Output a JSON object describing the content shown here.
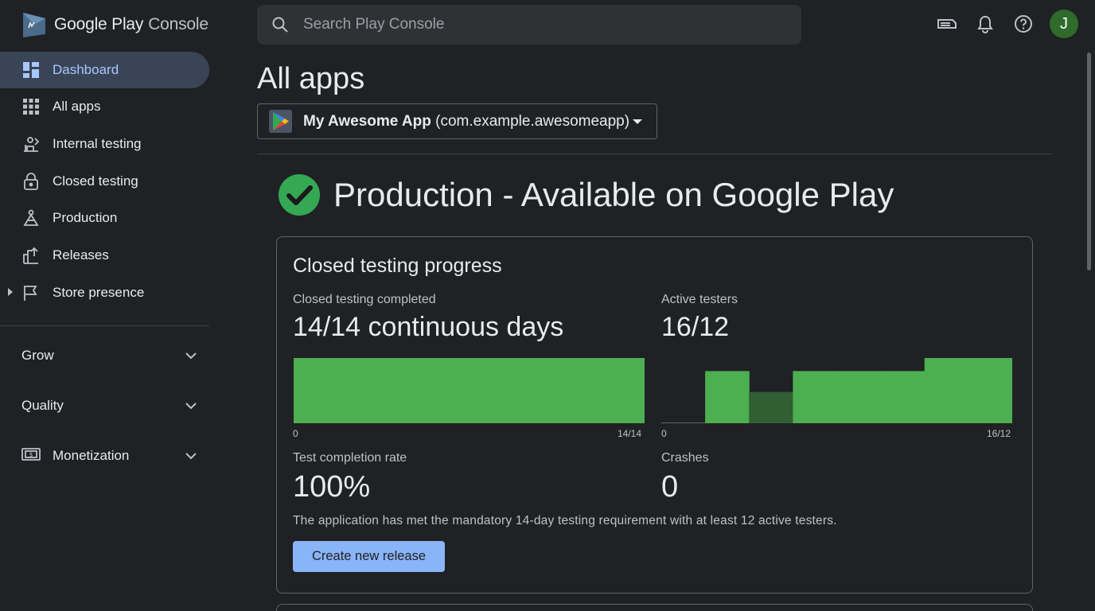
{
  "brand": {
    "google": "Google Play",
    "console": "Console"
  },
  "search": {
    "placeholder": "Search Play Console"
  },
  "topbar": {
    "icons": [
      "inbox-icon",
      "bell-icon",
      "help-icon"
    ],
    "avatar_letter": "J"
  },
  "sidebar": {
    "items": [
      {
        "label": "Dashboard",
        "icon": "dashboard-icon",
        "active": true
      },
      {
        "label": "All apps",
        "icon": "grid-icon"
      },
      {
        "label": "Internal testing",
        "icon": "internal-testing-icon"
      },
      {
        "label": "Closed testing",
        "icon": "lock-icon"
      },
      {
        "label": "Production",
        "icon": "production-icon"
      },
      {
        "label": "Releases",
        "icon": "releases-icon"
      },
      {
        "label": "Store presence",
        "icon": "flag-icon"
      }
    ],
    "sections": [
      {
        "label": "Grow"
      },
      {
        "label": "Quality"
      },
      {
        "label": "Monetization",
        "icon": "money-icon"
      }
    ]
  },
  "main": {
    "title": "All apps",
    "app_selector": {
      "name": "My Awesome App",
      "package": "(com.example.awesomeapp)"
    },
    "status": "Production - Available on Google Play",
    "card": {
      "title": "Closed testing progress",
      "metrics": {
        "days_label": "Closed testing completed",
        "days_value": "14/14 continuous days",
        "testers_label": "Active testers",
        "testers_value": "16/12",
        "rate_label": "Test completion rate",
        "rate_value": "100%",
        "crashes_label": "Crashes",
        "crashes_value": "0"
      },
      "note": "The application has met the mandatory 14-day testing requirement with at least 12 active testers.",
      "button": "Create new release"
    }
  },
  "chart_data": [
    {
      "type": "area",
      "name": "days",
      "x_tick_labels": [
        "0",
        "14/14"
      ],
      "values": [
        1,
        1,
        1,
        1,
        1,
        1,
        1,
        1
      ],
      "color": "#4caf50"
    },
    {
      "type": "bar",
      "name": "testers",
      "x_tick_labels": [
        "0",
        "16/12"
      ],
      "values": [
        0,
        0.8,
        0.48,
        0.8,
        0.8,
        0.8,
        1.0,
        1.0
      ],
      "colors": [
        "#4caf50",
        "#4caf50",
        "#2f5f33",
        "#4caf50",
        "#4caf50",
        "#4caf50",
        "#4caf50",
        "#4caf50"
      ]
    }
  ],
  "colors": {
    "accent": "#8ab4f8",
    "success": "#34a853",
    "bar": "#4caf50"
  }
}
